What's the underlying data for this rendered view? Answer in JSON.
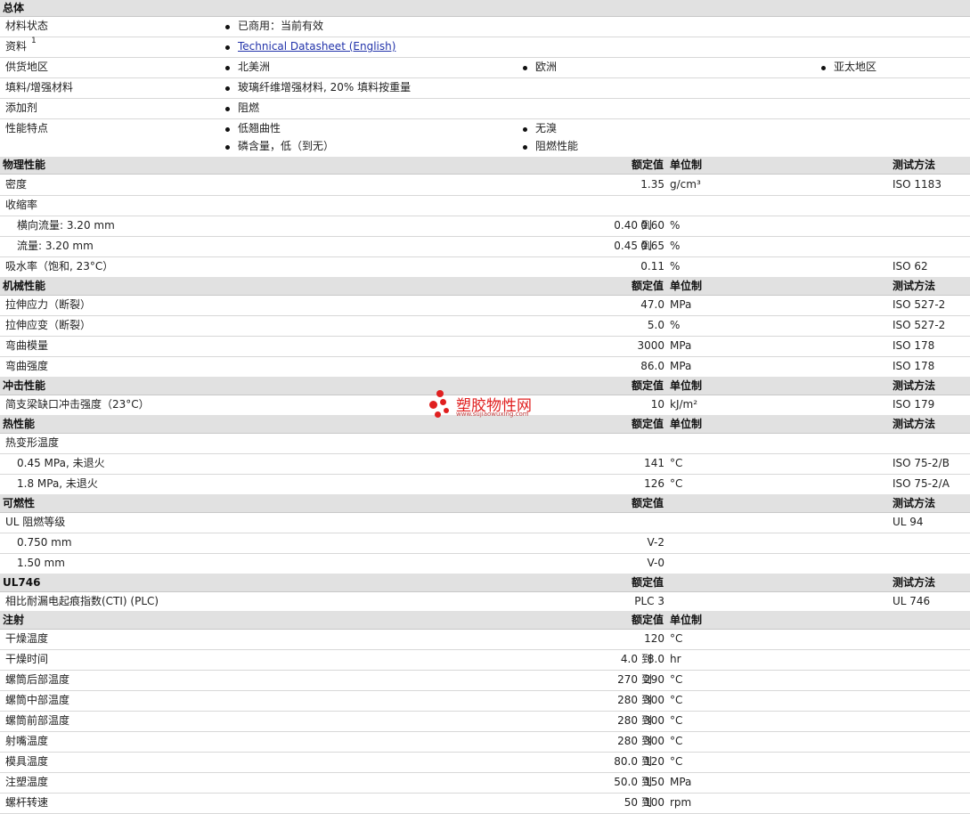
{
  "general": {
    "title": "总体",
    "status_label": "材料状态",
    "status_value": "已商用：当前有效",
    "docs_label": "资料",
    "docs_sup": "1",
    "docs_link": "Technical Datasheet (English)",
    "region_label": "供货地区",
    "regions": [
      "北美洲",
      "欧洲",
      "亚太地区"
    ],
    "filler_label": "填料/增强材料",
    "filler_value": "玻璃纤维增强材料, 20% 填料按重量",
    "additive_label": "添加剂",
    "additive_value": "阻燃",
    "features_label": "性能特点",
    "features": [
      "低翘曲性",
      "无溴",
      "磷含量，低（到无）",
      "阻燃性能"
    ]
  },
  "headers": {
    "nominal": "额定值",
    "unit": "单位制",
    "method": "测试方法"
  },
  "to": "到",
  "physical": {
    "title": "物理性能",
    "density_label": "密度",
    "density_value": "1.35",
    "density_unit": "g/cm³",
    "density_method": "ISO 1183",
    "shrink_label": "收缩率",
    "shrink_across_label": "横向流量: 3.20 mm",
    "shrink_across_lo": "0.40",
    "shrink_across_hi": "0.60",
    "shrink_across_unit": "%",
    "shrink_flow_label": "流量: 3.20 mm",
    "shrink_flow_lo": "0.45",
    "shrink_flow_hi": "0.65",
    "shrink_flow_unit": "%",
    "water_label": "吸水率（饱和, 23°C）",
    "water_value": "0.11",
    "water_unit": "%",
    "water_method": "ISO 62"
  },
  "mechanical": {
    "title": "机械性能",
    "rows": [
      {
        "label": "拉伸应力（断裂）",
        "value": "47.0",
        "unit": "MPa",
        "method": "ISO 527-2"
      },
      {
        "label": "拉伸应变（断裂）",
        "value": "5.0",
        "unit": "%",
        "method": "ISO 527-2"
      },
      {
        "label": "弯曲模量",
        "value": "3000",
        "unit": "MPa",
        "method": "ISO 178"
      },
      {
        "label": "弯曲强度",
        "value": "86.0",
        "unit": "MPa",
        "method": "ISO 178"
      }
    ]
  },
  "impact": {
    "title": "冲击性能",
    "label": "简支梁缺口冲击强度（23°C）",
    "value": "10",
    "unit": "kJ/m²",
    "method": "ISO 179"
  },
  "thermal": {
    "title": "热性能",
    "hdt_label": "热变形温度",
    "rows": [
      {
        "label": "0.45 MPa, 未退火",
        "value": "141",
        "unit": "°C",
        "method": "ISO 75-2/B"
      },
      {
        "label": "1.8 MPa, 未退火",
        "value": "126",
        "unit": "°C",
        "method": "ISO 75-2/A"
      }
    ]
  },
  "flammability": {
    "title": "可燃性",
    "ul_label": "UL 阻燃等级",
    "ul_method": "UL 94",
    "rows": [
      {
        "label": "0.750 mm",
        "value": "V-2"
      },
      {
        "label": "1.50 mm",
        "value": "V-0"
      }
    ]
  },
  "ul746": {
    "title": "UL746",
    "label": "相比耐漏电起痕指数(CTI) (PLC)",
    "value": "PLC 3",
    "method": "UL 746"
  },
  "injection": {
    "title": "注射",
    "rows": [
      {
        "label": "干燥温度",
        "lo": "",
        "hi": "120",
        "unit": "°C"
      },
      {
        "label": "干燥时间",
        "lo": "4.0",
        "hi": "8.0",
        "unit": "hr"
      },
      {
        "label": "螺筒后部温度",
        "lo": "270",
        "hi": "290",
        "unit": "°C"
      },
      {
        "label": "螺筒中部温度",
        "lo": "280",
        "hi": "300",
        "unit": "°C"
      },
      {
        "label": "螺筒前部温度",
        "lo": "280",
        "hi": "300",
        "unit": "°C"
      },
      {
        "label": "射嘴温度",
        "lo": "280",
        "hi": "300",
        "unit": "°C"
      },
      {
        "label": "模具温度",
        "lo": "80.0",
        "hi": "120",
        "unit": "°C"
      },
      {
        "label": "注塑温度",
        "lo": "50.0",
        "hi": "150",
        "unit": "MPa"
      },
      {
        "label": "螺杆转速",
        "lo": "50",
        "hi": "100",
        "unit": "rpm"
      }
    ]
  },
  "watermark": {
    "text": "塑胶物性网",
    "url": "www.sujiaowuxing.com",
    "color": "#e02020"
  }
}
